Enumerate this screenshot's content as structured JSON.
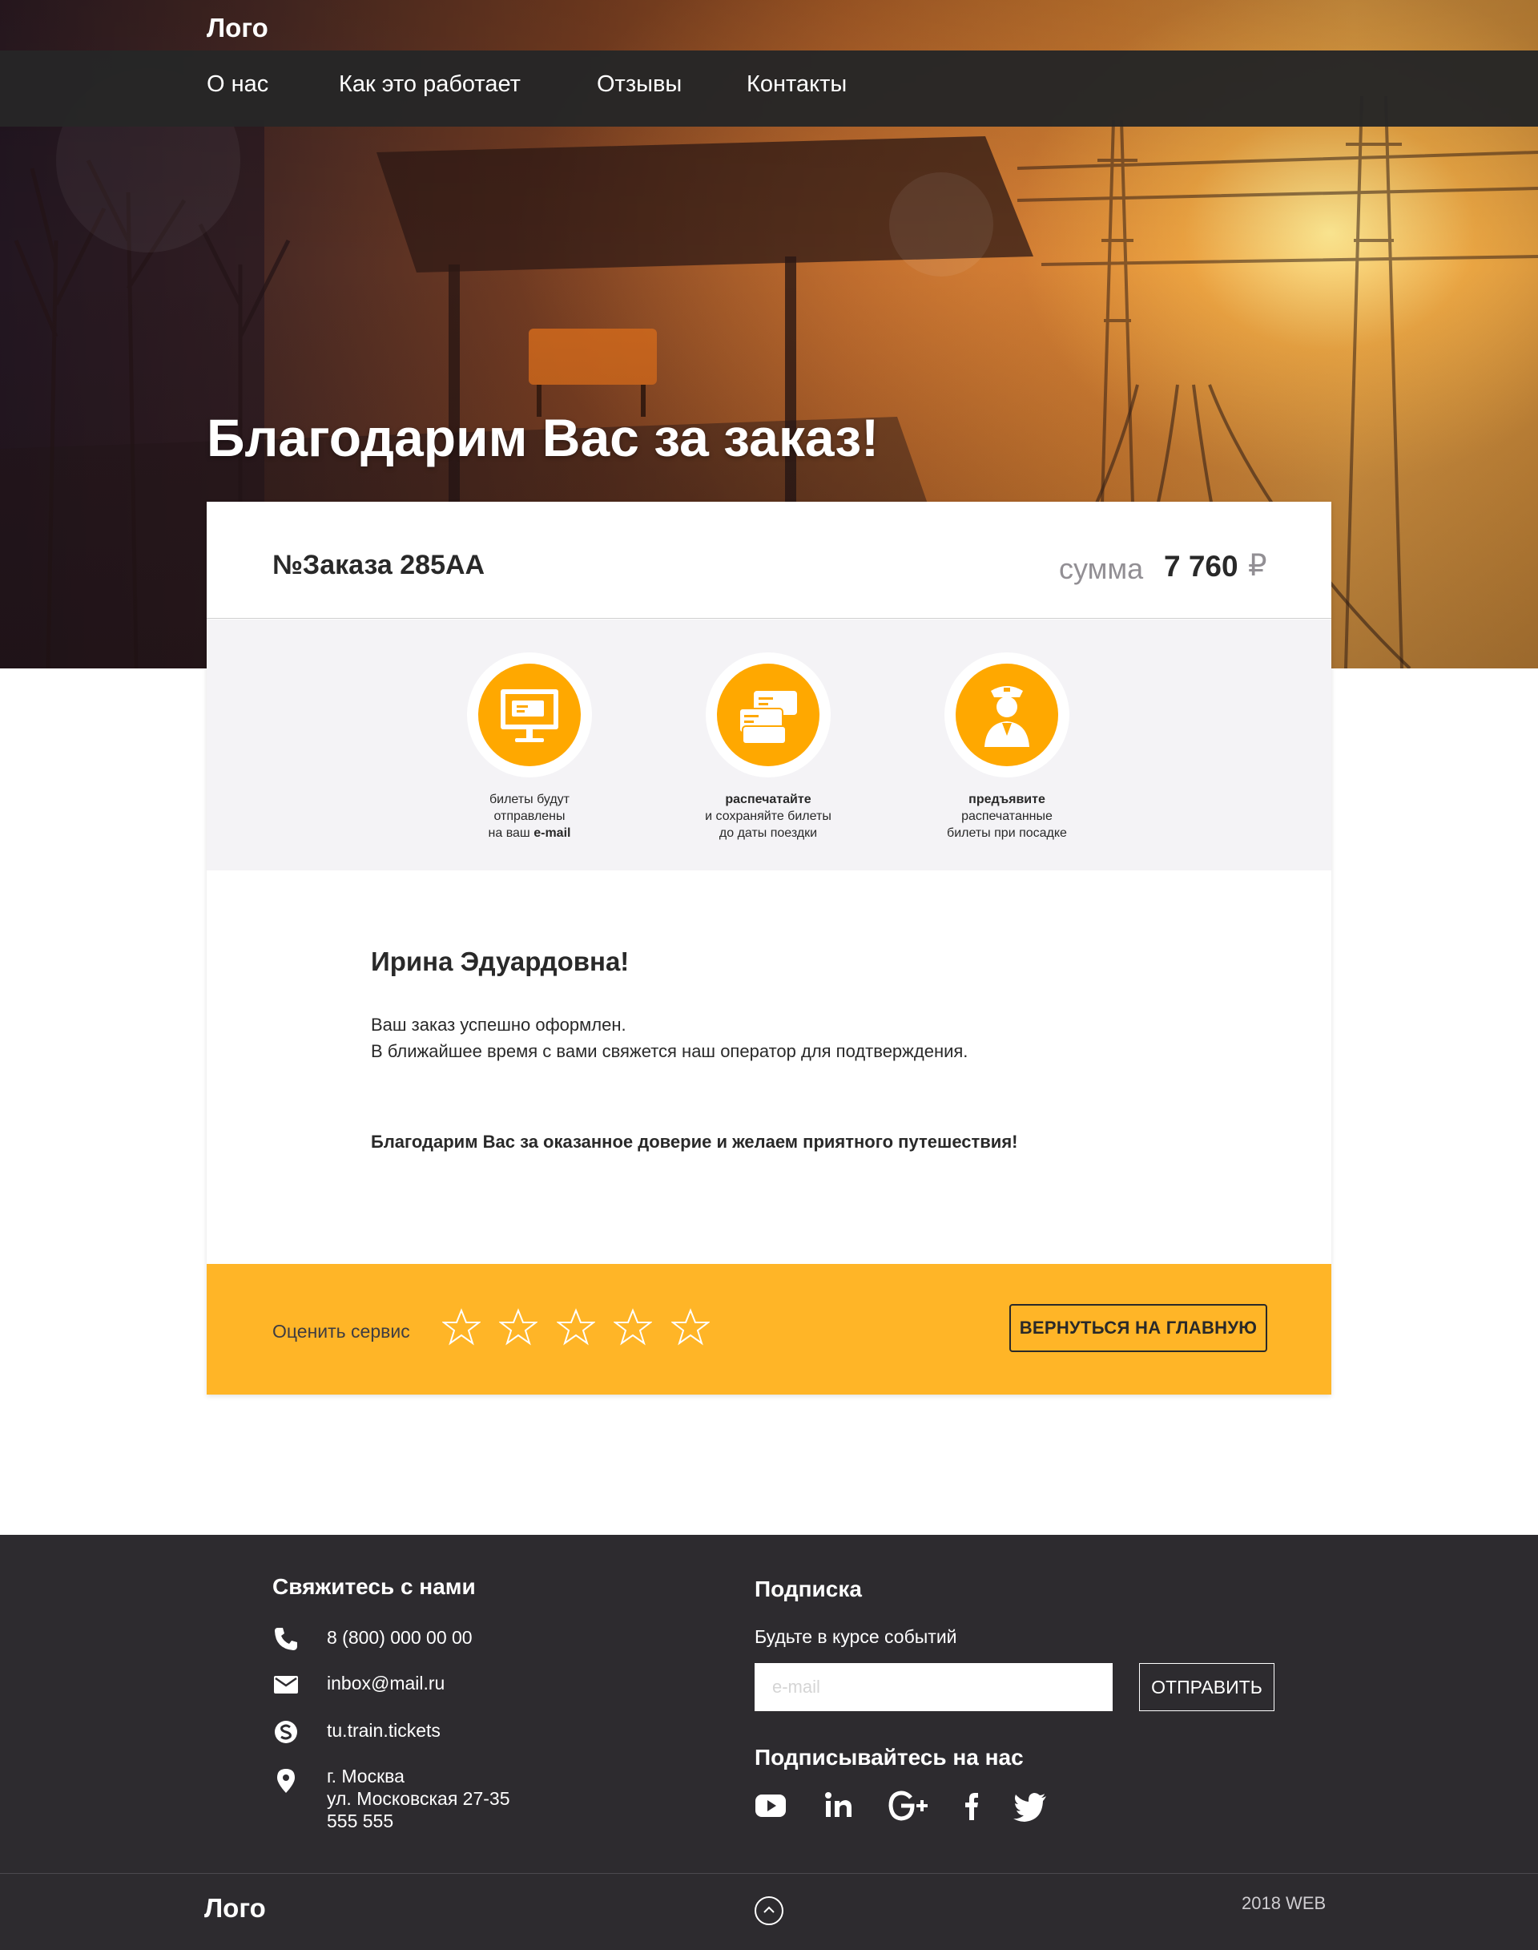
{
  "header": {
    "logo": "Лого",
    "nav": [
      "О нас",
      "Как это работает",
      "Отзывы",
      "Контакты"
    ]
  },
  "hero": {
    "title": "Благодарим Вас за заказ!"
  },
  "order": {
    "number_label": "№Заказа 285АА",
    "sum_label": "сумма",
    "sum_value": "7 760",
    "currency": "₽"
  },
  "steps": [
    {
      "icon": "monitor-ticket-icon",
      "lines": [
        "билеты будут",
        "отправлены",
        "на ваш e-mail"
      ],
      "bold_line": 2,
      "bold_part": "e-mail"
    },
    {
      "icon": "tickets-icon",
      "lines": [
        "распечатайте",
        "и сохраняйте билеты",
        "до даты поездки"
      ],
      "bold_line": 0
    },
    {
      "icon": "conductor-icon",
      "lines": [
        "предъявите",
        "распечатанные",
        "билеты при посадке"
      ],
      "bold_line": 0
    }
  ],
  "message": {
    "greeting": "Ирина Эдуардовна!",
    "line1": "Ваш заказ успешно оформлен.",
    "line2": "В ближайшее время с вами свяжется наш оператор для подтверждения.",
    "thanks": "Благодарим Вас за оказанное доверие и желаем приятного путешествия!"
  },
  "rating": {
    "label": "Оценить сервис",
    "stars_total": 5,
    "stars_selected": 0,
    "home_button": "ВЕРНУТЬСЯ НА ГЛАВНУЮ"
  },
  "footer": {
    "contacts_title": "Свяжитесь с нами",
    "phone": "8 (800) 000 00 00",
    "email": "inbox@mail.ru",
    "skype": "tu.train.tickets",
    "address": [
      "г. Москва",
      "ул. Московская 27-35",
      "555 555"
    ],
    "subscribe_title": "Подписка",
    "subscribe_hint": "Будьте в курсе событий",
    "email_placeholder": "e-mail",
    "send_button": "ОТПРАВИТЬ",
    "follow_title": "Подписывайтесь на нас",
    "socials": [
      "youtube-icon",
      "linkedin-icon",
      "google-plus-icon",
      "facebook-icon",
      "twitter-icon"
    ],
    "logo": "Лого",
    "copyright": "2018 WEB"
  },
  "colors": {
    "accent": "#ffa800",
    "rating_bar": "#ffb527",
    "nav_bg": "#262626",
    "footer_bg": "#2d2b2f",
    "steps_bg": "#f4f3f6"
  }
}
